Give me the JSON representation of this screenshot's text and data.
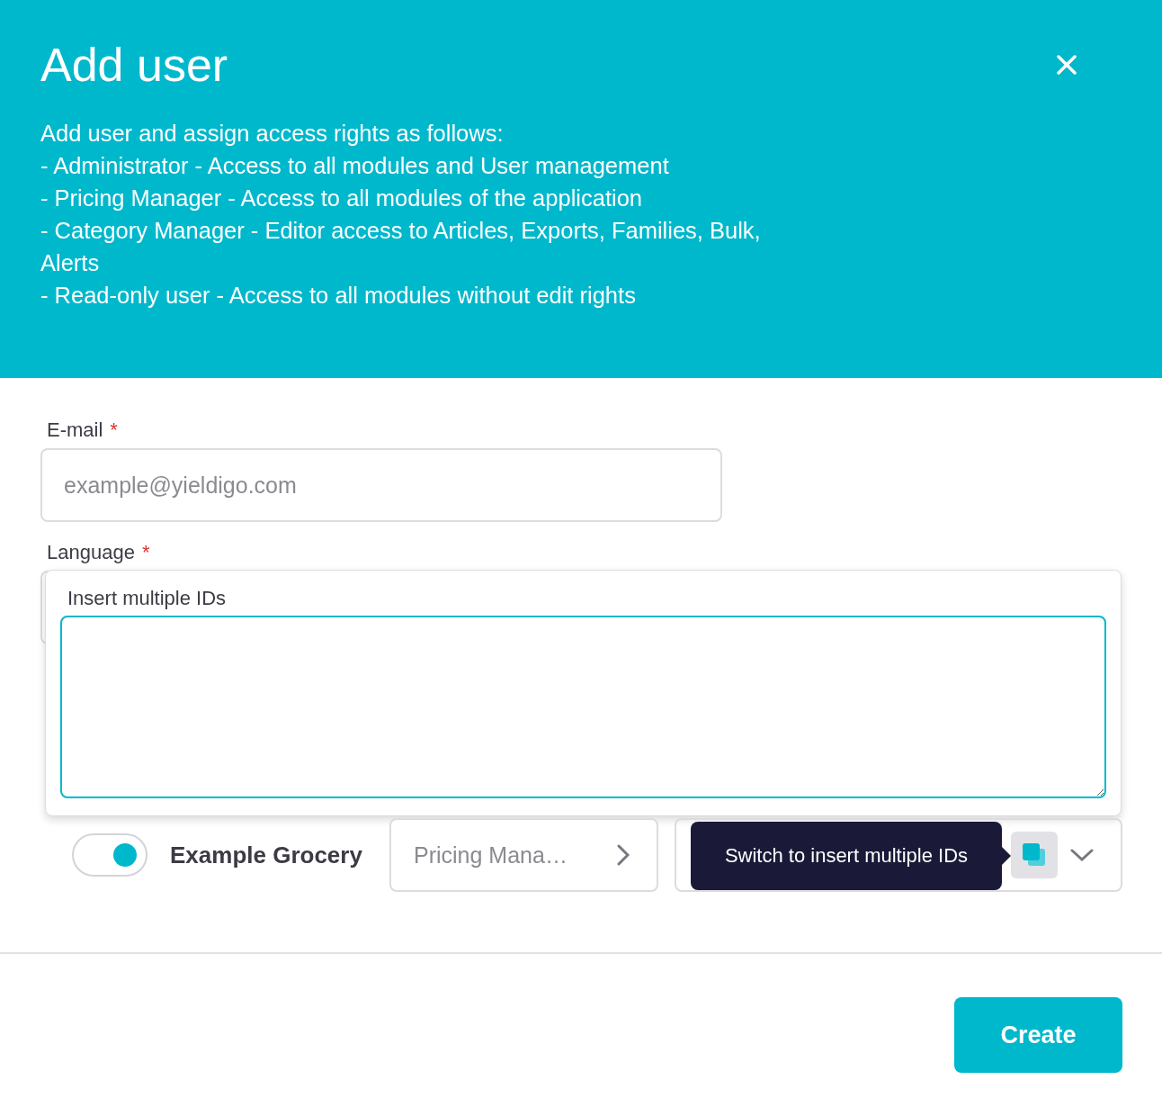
{
  "dialog": {
    "title": "Add user",
    "description": [
      "Add user and assign access rights as follows:",
      "- Administrator - Access to all modules and User management",
      "- Pricing Manager - Access to all modules of the application",
      "- Category Manager - Editor access to Articles, Exports, Families, Bulk, Alerts",
      "- Read-only user - Access to all modules without edit rights"
    ]
  },
  "form": {
    "fields": [
      {
        "kind": "input",
        "label": "E-mail",
        "required_mark": "*",
        "placeholder": "example@yieldigo.com"
      },
      {
        "kind": "select",
        "label": "Language",
        "required_mark": "*"
      }
    ]
  },
  "ids_popup": {
    "label": "Insert multiple IDs"
  },
  "access_row": {
    "on": true,
    "name": "Example Grocery",
    "role_value": "Pricing Mana…"
  },
  "tooltip": {
    "text": "Switch to insert multiple IDs"
  },
  "footer": {
    "button": "Create"
  }
}
